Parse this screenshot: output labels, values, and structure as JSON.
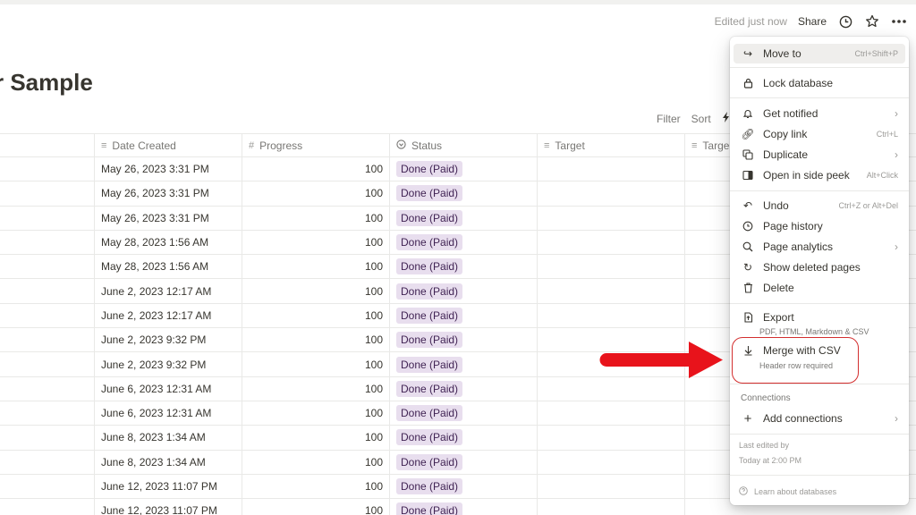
{
  "header": {
    "edited_label": "Edited just now",
    "share_label": "Share",
    "icons": [
      "clock-icon",
      "star-icon",
      "more-icon"
    ]
  },
  "page": {
    "title": "r Sample"
  },
  "toolbar": {
    "filter_label": "Filter",
    "sort_label": "Sort",
    "automation_icon": "lightning-icon"
  },
  "table": {
    "columns": [
      {
        "name": "",
        "icon": ""
      },
      {
        "name": "Date Created",
        "icon": "lines-icon"
      },
      {
        "name": "Progress",
        "icon": "hash-icon"
      },
      {
        "name": "Status",
        "icon": "status-icon"
      },
      {
        "name": "Target",
        "icon": "lines-icon"
      },
      {
        "name": "Targe",
        "icon": "lines-icon"
      }
    ],
    "rows": [
      {
        "date": "May 26, 2023 3:31 PM",
        "progress": "100",
        "status": "Done (Paid)"
      },
      {
        "date": "May 26, 2023 3:31 PM",
        "progress": "100",
        "status": "Done (Paid)"
      },
      {
        "date": "May 26, 2023 3:31 PM",
        "progress": "100",
        "status": "Done (Paid)"
      },
      {
        "date": "May 28, 2023 1:56 AM",
        "progress": "100",
        "status": "Done (Paid)"
      },
      {
        "date": "May 28, 2023 1:56 AM",
        "progress": "100",
        "status": "Done (Paid)"
      },
      {
        "date": "June 2, 2023 12:17 AM",
        "progress": "100",
        "status": "Done (Paid)"
      },
      {
        "date": "June 2, 2023 12:17 AM",
        "progress": "100",
        "status": "Done (Paid)"
      },
      {
        "date": "June 2, 2023 9:32 PM",
        "progress": "100",
        "status": "Done (Paid)"
      },
      {
        "date": "June 2, 2023 9:32 PM",
        "progress": "100",
        "status": "Done (Paid)"
      },
      {
        "date": "June 6, 2023 12:31 AM",
        "progress": "100",
        "status": "Done (Paid)"
      },
      {
        "date": "June 6, 2023 12:31 AM",
        "progress": "100",
        "status": "Done (Paid)"
      },
      {
        "date": "June 8, 2023 1:34 AM",
        "progress": "100",
        "status": "Done (Paid)"
      },
      {
        "date": "June 8, 2023 1:34 AM",
        "progress": "100",
        "status": "Done (Paid)"
      },
      {
        "date": "June 12, 2023 11:07 PM",
        "progress": "100",
        "status": "Done (Paid)"
      },
      {
        "date": "June 12, 2023 11:07 PM",
        "progress": "100",
        "status": "Done (Paid)"
      }
    ]
  },
  "menu": {
    "move_to": {
      "label": "Move to",
      "shortcut": "Ctrl+Shift+P"
    },
    "lock": {
      "label": "Lock database"
    },
    "get_notified": {
      "label": "Get notified"
    },
    "copy_link": {
      "label": "Copy link",
      "shortcut": "Ctrl+L"
    },
    "duplicate": {
      "label": "Duplicate"
    },
    "side_peek": {
      "label": "Open in side peek",
      "shortcut": "Alt+Click"
    },
    "undo": {
      "label": "Undo",
      "shortcut": "Ctrl+Z or Alt+Del"
    },
    "page_history": {
      "label": "Page history"
    },
    "page_analytics": {
      "label": "Page analytics"
    },
    "show_deleted": {
      "label": "Show deleted pages"
    },
    "delete": {
      "label": "Delete"
    },
    "export": {
      "label": "Export",
      "sub": "PDF, HTML, Markdown & CSV"
    },
    "merge": {
      "label": "Merge with CSV",
      "sub": "Header row required"
    },
    "connections_heading": "Connections",
    "add_connections": {
      "label": "Add connections"
    },
    "last_edited_by": "Last edited by",
    "last_edited_time": "Today at 2:00 PM",
    "learn": "Learn about databases"
  },
  "annotation": {
    "highlight_color": "#d32f2f",
    "arrow_color": "#e8131b"
  }
}
